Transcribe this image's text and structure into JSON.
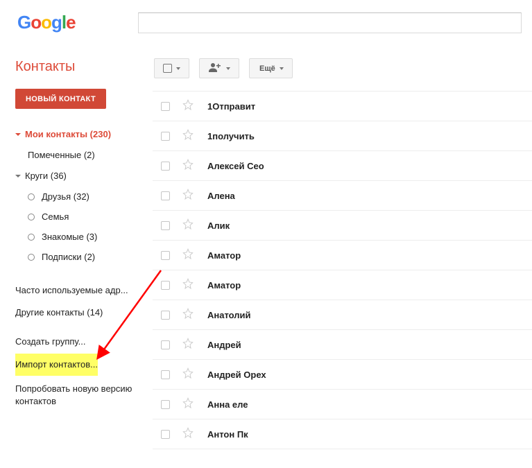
{
  "header": {
    "logo": {
      "letters": [
        {
          "char": "G",
          "color": "#4285F4"
        },
        {
          "char": "o",
          "color": "#EA4335"
        },
        {
          "char": "o",
          "color": "#FBBC05"
        },
        {
          "char": "g",
          "color": "#4285F4"
        },
        {
          "char": "l",
          "color": "#34A853"
        },
        {
          "char": "e",
          "color": "#EA4335"
        }
      ]
    },
    "search_value": ""
  },
  "sidebar": {
    "app_title": "Контакты",
    "new_contact_label": "НОВЫЙ КОНТАКТ",
    "my_contacts": {
      "label": "Мои контакты (230)",
      "items": [
        {
          "label": "Помеченные (2)"
        }
      ]
    },
    "circles": {
      "label": "Круги (36)",
      "items": [
        {
          "label": "Друзья (32)"
        },
        {
          "label": "Семья"
        },
        {
          "label": "Знакомые (3)"
        },
        {
          "label": "Подписки (2)"
        }
      ]
    },
    "extras": [
      {
        "label": "Часто используемые адр..."
      },
      {
        "label": "Другие контакты (14)"
      }
    ],
    "actions": [
      {
        "label": "Создать группу..."
      },
      {
        "label": "Импорт контактов...",
        "highlight": true
      },
      {
        "label": "Попробовать новую версию контактов",
        "multiline": true
      }
    ]
  },
  "toolbar": {
    "more_label": "Ещё"
  },
  "contacts": [
    {
      "name": "1Отправит"
    },
    {
      "name": "1получить"
    },
    {
      "name": "Алексей Сео"
    },
    {
      "name": "Алена"
    },
    {
      "name": "Алик"
    },
    {
      "name": "Аматор"
    },
    {
      "name": "Аматор"
    },
    {
      "name": "Анатолий"
    },
    {
      "name": "Андрей"
    },
    {
      "name": "Андрей Орех"
    },
    {
      "name": "Анна еле"
    },
    {
      "name": "Антон Пк"
    }
  ]
}
